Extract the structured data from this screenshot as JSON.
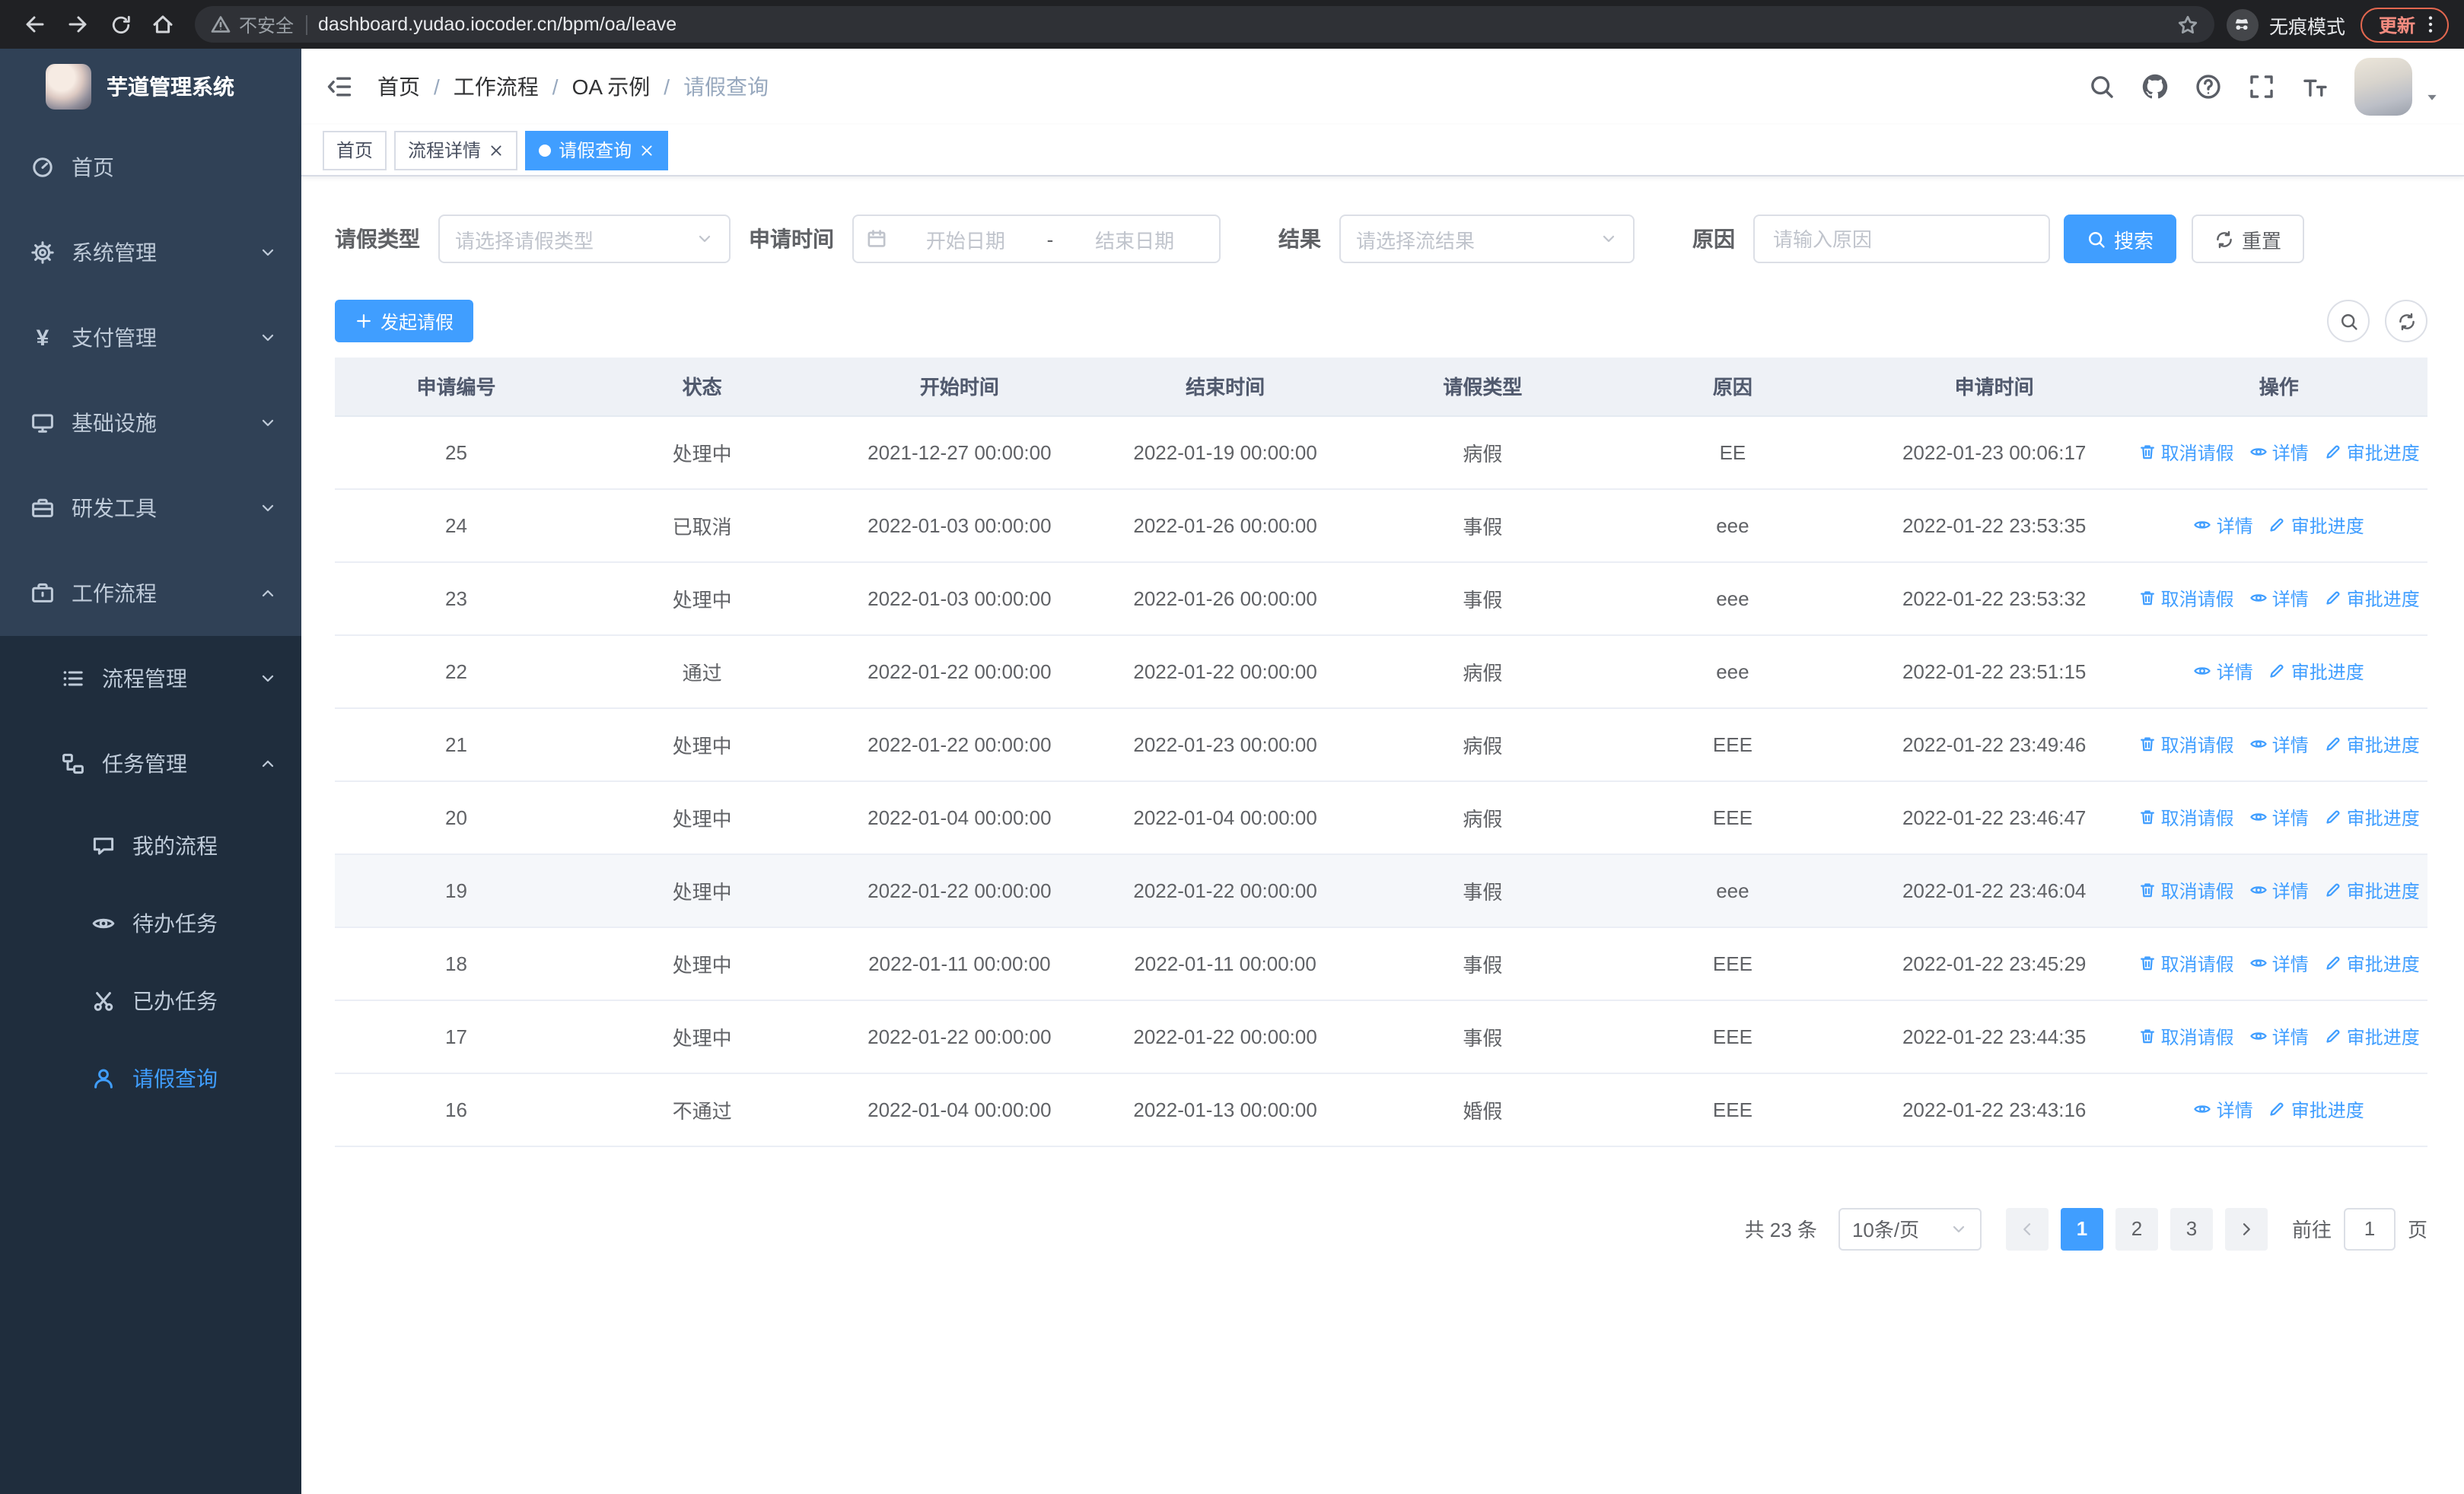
{
  "browser": {
    "security_label": "不安全",
    "url": "dashboard.yudao.iocoder.cn/bpm/oa/leave",
    "incognito_label": "无痕模式",
    "update_label": "更新"
  },
  "sidebar": {
    "title": "芋道管理系统",
    "items": [
      {
        "label": "首页",
        "icon": "dashboard"
      },
      {
        "label": "系统管理",
        "icon": "gear"
      },
      {
        "label": "支付管理",
        "icon": "yen"
      },
      {
        "label": "基础设施",
        "icon": "monitor"
      },
      {
        "label": "研发工具",
        "icon": "toolbox"
      },
      {
        "label": "工作流程",
        "icon": "workflow"
      },
      {
        "label": "流程管理",
        "icon": "process"
      },
      {
        "label": "任务管理",
        "icon": "tasks"
      },
      {
        "label": "我的流程",
        "icon": "chat"
      },
      {
        "label": "待办任务",
        "icon": "eye"
      },
      {
        "label": "已办任务",
        "icon": "scissors"
      },
      {
        "label": "请假查询",
        "icon": "user"
      }
    ]
  },
  "breadcrumb": {
    "separator": "/",
    "items": [
      "首页",
      "工作流程",
      "OA 示例",
      "请假查询"
    ]
  },
  "tabs": [
    {
      "label": "首页"
    },
    {
      "label": "流程详情"
    },
    {
      "label": "请假查询"
    }
  ],
  "filters": {
    "leave_type": {
      "label": "请假类型",
      "placeholder": "请选择请假类型"
    },
    "apply_time": {
      "label": "申请时间",
      "start_placeholder": "开始日期",
      "separator": "-",
      "end_placeholder": "结束日期"
    },
    "result": {
      "label": "结果",
      "placeholder": "请选择流结果"
    },
    "reason": {
      "label": "原因",
      "placeholder": "请输入原因"
    },
    "search_label": "搜索",
    "reset_label": "重置"
  },
  "toolbar": {
    "create_label": "发起请假"
  },
  "table": {
    "columns": [
      "申请编号",
      "状态",
      "开始时间",
      "结束时间",
      "请假类型",
      "原因",
      "申请时间",
      "操作"
    ],
    "op_labels": {
      "cancel": "取消请假",
      "detail": "详情",
      "progress": "审批进度"
    },
    "rows": [
      {
        "id": "25",
        "status": "处理中",
        "start": "2021-12-27 00:00:00",
        "end": "2022-01-19 00:00:00",
        "type": "病假",
        "reason": "EE",
        "apply_time": "2022-01-23 00:06:17"
      },
      {
        "id": "24",
        "status": "已取消",
        "start": "2022-01-03 00:00:00",
        "end": "2022-01-26 00:00:00",
        "type": "事假",
        "reason": "eee",
        "apply_time": "2022-01-22 23:53:35"
      },
      {
        "id": "23",
        "status": "处理中",
        "start": "2022-01-03 00:00:00",
        "end": "2022-01-26 00:00:00",
        "type": "事假",
        "reason": "eee",
        "apply_time": "2022-01-22 23:53:32"
      },
      {
        "id": "22",
        "status": "通过",
        "start": "2022-01-22 00:00:00",
        "end": "2022-01-22 00:00:00",
        "type": "病假",
        "reason": "eee",
        "apply_time": "2022-01-22 23:51:15"
      },
      {
        "id": "21",
        "status": "处理中",
        "start": "2022-01-22 00:00:00",
        "end": "2022-01-23 00:00:00",
        "type": "病假",
        "reason": "EEE",
        "apply_time": "2022-01-22 23:49:46"
      },
      {
        "id": "20",
        "status": "处理中",
        "start": "2022-01-04 00:00:00",
        "end": "2022-01-04 00:00:00",
        "type": "病假",
        "reason": "EEE",
        "apply_time": "2022-01-22 23:46:47"
      },
      {
        "id": "19",
        "status": "处理中",
        "start": "2022-01-22 00:00:00",
        "end": "2022-01-22 00:00:00",
        "type": "事假",
        "reason": "eee",
        "apply_time": "2022-01-22 23:46:04"
      },
      {
        "id": "18",
        "status": "处理中",
        "start": "2022-01-11 00:00:00",
        "end": "2022-01-11 00:00:00",
        "type": "事假",
        "reason": "EEE",
        "apply_time": "2022-01-22 23:45:29"
      },
      {
        "id": "17",
        "status": "处理中",
        "start": "2022-01-22 00:00:00",
        "end": "2022-01-22 00:00:00",
        "type": "事假",
        "reason": "EEE",
        "apply_time": "2022-01-22 23:44:35"
      },
      {
        "id": "16",
        "status": "不通过",
        "start": "2022-01-04 00:00:00",
        "end": "2022-01-13 00:00:00",
        "type": "婚假",
        "reason": "EEE",
        "apply_time": "2022-01-22 23:43:16"
      }
    ]
  },
  "pagination": {
    "total_label": "共 23 条",
    "page_size_label": "10条/页",
    "pages": [
      "1",
      "2",
      "3"
    ],
    "active_page": "1",
    "goto_label": "前往",
    "goto_value": "1",
    "page_unit": "页"
  },
  "colors": {
    "accent": "#409eff",
    "sidebar_bg": "#304156",
    "submenu_bg": "#1f2d3d"
  }
}
